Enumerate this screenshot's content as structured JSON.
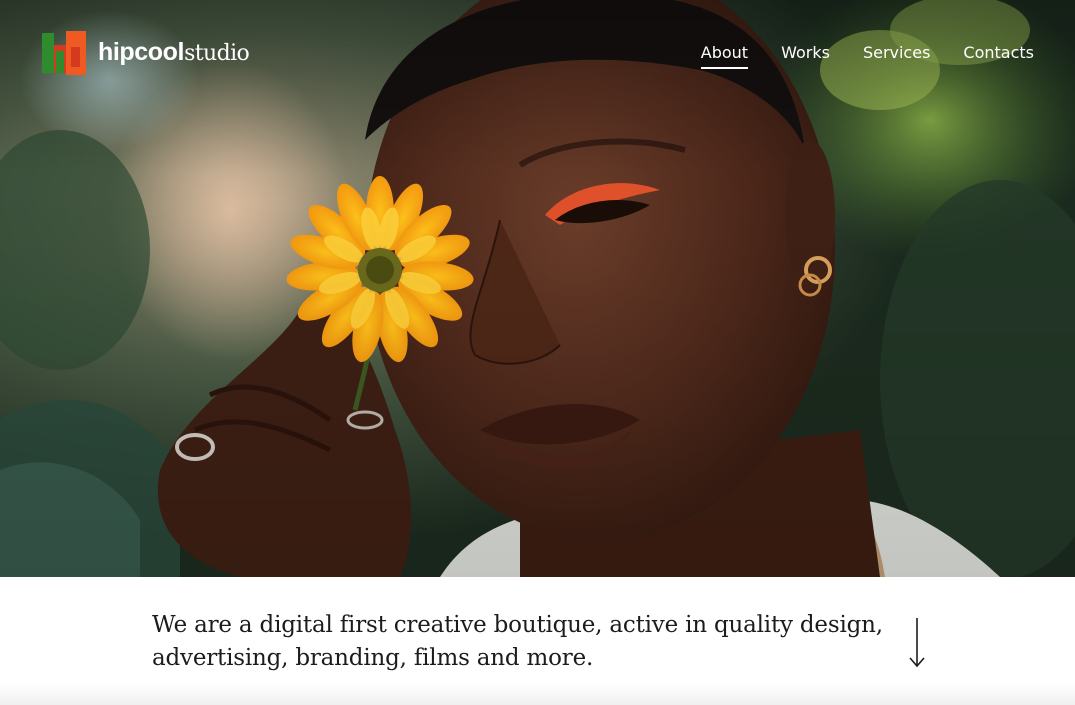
{
  "brand": {
    "name_bold": "hipcool",
    "name_light": "studio",
    "colors": {
      "green": "#2e8b2e",
      "orange": "#ee5a22",
      "red": "#d63a1e"
    }
  },
  "nav": {
    "items": [
      {
        "label": "About",
        "active": true
      },
      {
        "label": "Works",
        "active": false
      },
      {
        "label": "Services",
        "active": false
      },
      {
        "label": "Contacts",
        "active": false
      }
    ]
  },
  "hero": {
    "icon": "hero-portrait-image"
  },
  "intro": {
    "text": "We are a digital first creative boutique, active in quality design, advertising, branding, films and more.",
    "scroll_icon": "arrow-down-icon"
  }
}
